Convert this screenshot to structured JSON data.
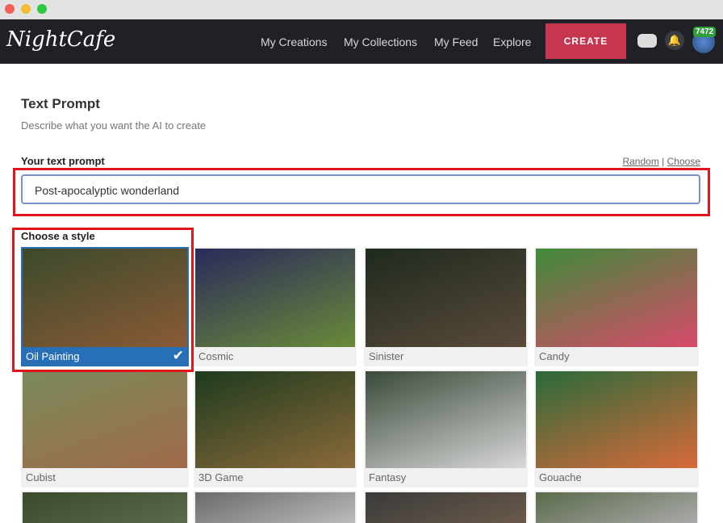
{
  "nav": {
    "logo": "NightCafe",
    "links": [
      "My Creations",
      "My Collections",
      "My Feed",
      "Explore"
    ],
    "create": "CREATE",
    "credits": "7472"
  },
  "section": {
    "title": "Text Prompt",
    "subtitle": "Describe what you want the AI to create"
  },
  "prompt": {
    "label": "Your text prompt",
    "random": "Random",
    "sep": " | ",
    "choose": "Choose",
    "value": "Post-apocalyptic wonderland"
  },
  "styles": {
    "label": "Choose a style",
    "selected": "Oil Painting",
    "items": [
      {
        "name": "Oil Painting",
        "c1": "#3b4a2c",
        "c2": "#8a5a36"
      },
      {
        "name": "Cosmic",
        "c1": "#2a2a5a",
        "c2": "#6a8a3a"
      },
      {
        "name": "Sinister",
        "c1": "#1e2a1e",
        "c2": "#5a4a3a"
      },
      {
        "name": "Candy",
        "c1": "#3f8a3a",
        "c2": "#d84a6a"
      },
      {
        "name": "Cubist",
        "c1": "#7a8a5a",
        "c2": "#a06a4a"
      },
      {
        "name": "3D Game",
        "c1": "#1e3a1e",
        "c2": "#8a6a3a"
      },
      {
        "name": "Fantasy",
        "c1": "#3a4a3a",
        "c2": "#d8d8d8"
      },
      {
        "name": "Gouache",
        "c1": "#2a6a3a",
        "c2": "#d86a3a"
      },
      {
        "name": "",
        "c1": "#3a4a2a",
        "c2": "#5a6a4a"
      },
      {
        "name": "",
        "c1": "#6a6a6a",
        "c2": "#bbbbbb"
      },
      {
        "name": "",
        "c1": "#3a3a3a",
        "c2": "#6a5a4a"
      },
      {
        "name": "",
        "c1": "#5a6a4a",
        "c2": "#aaa"
      }
    ]
  }
}
